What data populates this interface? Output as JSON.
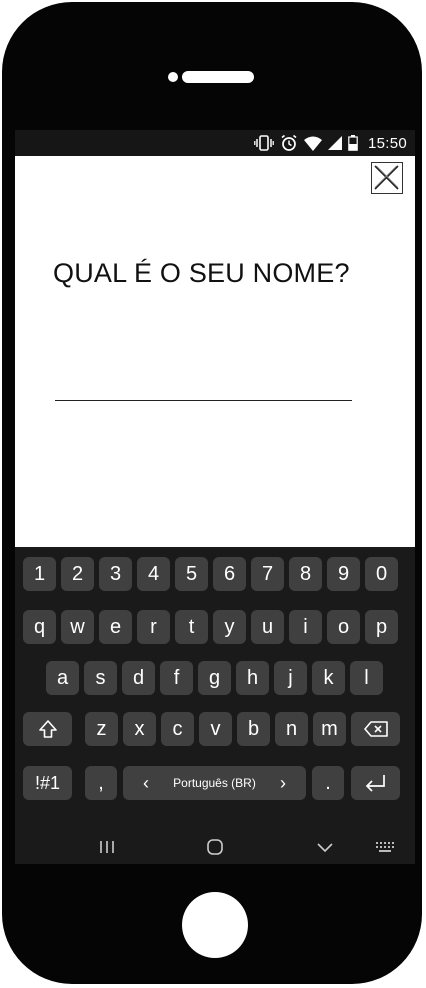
{
  "status_bar": {
    "time": "15:50",
    "icons": [
      "vibrate-icon",
      "alarm-icon",
      "wifi-icon",
      "signal-icon",
      "battery-icon"
    ]
  },
  "content": {
    "question": "QUAL É O SEU NOME?",
    "name_value": "",
    "close_icon": "close-icon"
  },
  "keyboard": {
    "number_row": [
      "1",
      "2",
      "3",
      "4",
      "5",
      "6",
      "7",
      "8",
      "9",
      "0"
    ],
    "row1": [
      "q",
      "w",
      "e",
      "r",
      "t",
      "y",
      "u",
      "i",
      "o",
      "p"
    ],
    "row2": [
      "a",
      "s",
      "d",
      "f",
      "g",
      "h",
      "j",
      "k",
      "l"
    ],
    "row3": [
      "z",
      "x",
      "c",
      "v",
      "b",
      "n",
      "m"
    ],
    "symbols_label": "!#1",
    "comma_label": ",",
    "language_label": "Português (BR)",
    "lang_prev": "‹",
    "lang_next": "›",
    "period_label": ".",
    "shift_icon": "shift-icon",
    "backspace_icon": "backspace-icon",
    "enter_icon": "enter-icon"
  },
  "navbar": {
    "icons": [
      "recents-icon",
      "home-icon",
      "back-icon",
      "keyboard-icon"
    ]
  },
  "colors": {
    "phone_body": "#050505",
    "keyboard_bg": "#1a1a1a",
    "key_bg": "#404040",
    "status_bar_bg": "#161616"
  }
}
